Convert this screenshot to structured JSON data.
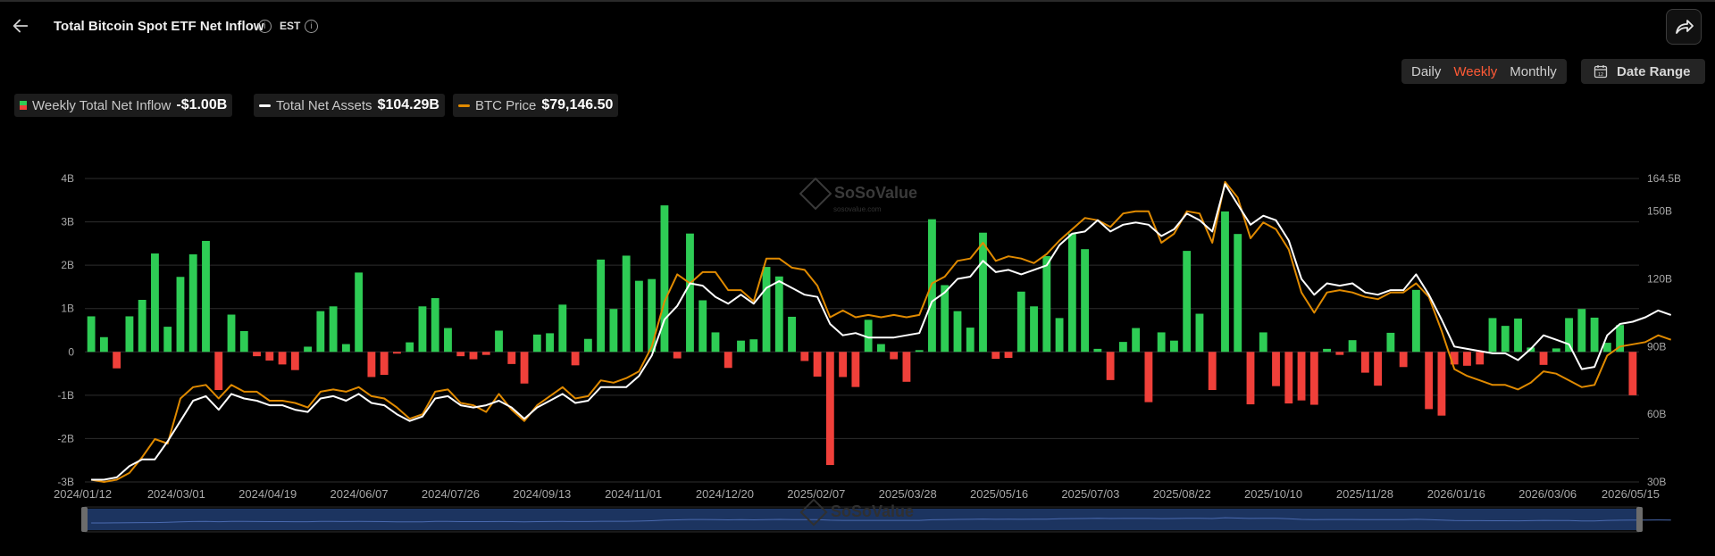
{
  "header": {
    "title": "Total Bitcoin Spot ETF Net Inflow",
    "timezone": "EST",
    "info_glyph": "i"
  },
  "periods": [
    "Daily",
    "Weekly",
    "Monthly"
  ],
  "active_period": "Weekly",
  "date_range_label": "Date Range",
  "legend": [
    {
      "name": "Weekly Total Net Inflow",
      "value": "-$1.00B"
    },
    {
      "name": "Total Net Assets",
      "value": "$104.29B"
    },
    {
      "name": "BTC Price",
      "value": "$79,146.50"
    }
  ],
  "watermark": "SoSoValue",
  "watermark_sub": "sosovalue.com",
  "colors": {
    "inflow_positive": "#2ecc55",
    "inflow_negative": "#f0403a",
    "net_assets_line": "#ffffff",
    "btc_price_line": "#e08a00",
    "grid": "#2e2e2e",
    "navigator": "#1c3460",
    "accent": "#ff5a36"
  },
  "icons": [
    "back-arrow-icon",
    "info-icon",
    "share-icon",
    "calendar-icon"
  ],
  "chart_data": {
    "type": "bar",
    "title": "",
    "x_tick_labels": [
      "2024/01/12",
      "2024/03/01",
      "2024/04/19",
      "2024/06/07",
      "2024/07/26",
      "2024/09/13",
      "2024/11/01",
      "2024/12/20",
      "2025/02/07",
      "2025/03/28",
      "2025/05/16",
      "2025/07/03",
      "2025/08/22",
      "2025/10/10",
      "2025/11/28",
      "2026/01/16",
      "2026/03/06",
      "2026/05/15"
    ],
    "y_left_ticks": [
      "4B",
      "3B",
      "2B",
      "1B",
      "0",
      "-1B",
      "-2B",
      "-3B"
    ],
    "y_left_range": [
      -3,
      4
    ],
    "y_right_ticks": [
      "164.5B",
      "150B",
      "120B",
      "90B",
      "60B",
      "30B"
    ],
    "y_right_values": [
      164.5,
      150,
      120,
      90,
      60,
      30
    ],
    "y_right_range": [
      30,
      164.5
    ],
    "grid": true,
    "series": [
      {
        "name": "Weekly Total Net Inflow",
        "type": "bar",
        "axis": "left",
        "values": [
          0.82,
          0.34,
          -0.38,
          0.82,
          1.2,
          2.27,
          0.58,
          1.73,
          2.25,
          2.56,
          -0.88,
          0.86,
          0.48,
          -0.1,
          -0.2,
          -0.29,
          -0.42,
          0.12,
          0.94,
          1.05,
          0.18,
          1.83,
          -0.58,
          -0.53,
          -0.04,
          0.22,
          1.05,
          1.24,
          0.55,
          -0.1,
          -0.17,
          -0.07,
          0.49,
          -0.28,
          -0.73,
          0.4,
          0.43,
          1.09,
          -0.31,
          0.3,
          2.13,
          0.99,
          2.22,
          1.64,
          1.68,
          3.38,
          -0.15,
          2.73,
          1.19,
          0.45,
          -0.37,
          0.26,
          0.29,
          1.96,
          1.74,
          0.81,
          -0.21,
          -0.57,
          -2.61,
          -0.58,
          -0.81,
          0.74,
          0.18,
          -0.17,
          -0.69,
          0.04,
          3.06,
          1.54,
          0.94,
          0.56,
          2.75,
          -0.16,
          -0.14,
          1.39,
          1.05,
          2.21,
          0.78,
          2.73,
          2.37,
          0.07,
          -0.65,
          0.23,
          0.55,
          -1.16,
          0.45,
          0.26,
          2.33,
          0.88,
          -0.88,
          3.24,
          2.72,
          -1.21,
          0.45,
          -0.79,
          -1.19,
          -1.12,
          -1.22,
          0.07,
          -0.07,
          0.27,
          -0.48,
          -0.78,
          0.44,
          -0.35,
          1.43,
          -1.32,
          -1.47,
          -0.29,
          -0.32,
          -0.29,
          0.78,
          0.6,
          0.77,
          0.1,
          -0.3,
          0.08,
          0.78,
          0.99,
          0.79,
          0.21,
          0.62,
          -1.0
        ]
      },
      {
        "name": "Total Net Assets",
        "type": "line",
        "axis": "right",
        "values": [
          31,
          31,
          32,
          37,
          40,
          40,
          48,
          57,
          66,
          68,
          62,
          69,
          67,
          66,
          64,
          64,
          62,
          61,
          67,
          68,
          66,
          69,
          65,
          64,
          60,
          57,
          59,
          67,
          68,
          64,
          63,
          64,
          66,
          63,
          58,
          63,
          66,
          69,
          65,
          66,
          72,
          72,
          72,
          77,
          86,
          102,
          108,
          118,
          117,
          112,
          109,
          113,
          109,
          116,
          119,
          116,
          113,
          112,
          100,
          95,
          96,
          94,
          94,
          94,
          95,
          96,
          110,
          114,
          120,
          121,
          128,
          123,
          124,
          122,
          124,
          126,
          135,
          140,
          141,
          146,
          141,
          144,
          145,
          144,
          139,
          142,
          149,
          146,
          141,
          162,
          153,
          144,
          148,
          146,
          137,
          120,
          113,
          118,
          117,
          118,
          114,
          113,
          115,
          115,
          122,
          113,
          102,
          90,
          89,
          88,
          87,
          87,
          84,
          89,
          95,
          93,
          91,
          80,
          81,
          95,
          100,
          101,
          103,
          106,
          104
        ]
      },
      {
        "name": "BTC Price",
        "type": "line",
        "axis": "right",
        "values": [
          31,
          30,
          31,
          34,
          41,
          49,
          47,
          67,
          72,
          73,
          67,
          73,
          70,
          70,
          66,
          66,
          65,
          63,
          70,
          71,
          70,
          72,
          68,
          67,
          63,
          58,
          60,
          70,
          71,
          65,
          64,
          61,
          69,
          62,
          57,
          64,
          68,
          72,
          67,
          68,
          75,
          74,
          76,
          79,
          90,
          110,
          122,
          118,
          123,
          123,
          115,
          115,
          110,
          129,
          129,
          125,
          124,
          117,
          103,
          106,
          103,
          104,
          103,
          104,
          103,
          104,
          118,
          121,
          128,
          129,
          136,
          128,
          130,
          129,
          127,
          131,
          137,
          142,
          147,
          146,
          143,
          149,
          150,
          150,
          136,
          140,
          150,
          149,
          136,
          163,
          156,
          138,
          145,
          142,
          133,
          114,
          105,
          114,
          115,
          114,
          112,
          111,
          114,
          114,
          118,
          112,
          97,
          80,
          77,
          75,
          73,
          73,
          71,
          74,
          79,
          78,
          75,
          72,
          73,
          86,
          90,
          91,
          92,
          95,
          93
        ]
      }
    ]
  }
}
